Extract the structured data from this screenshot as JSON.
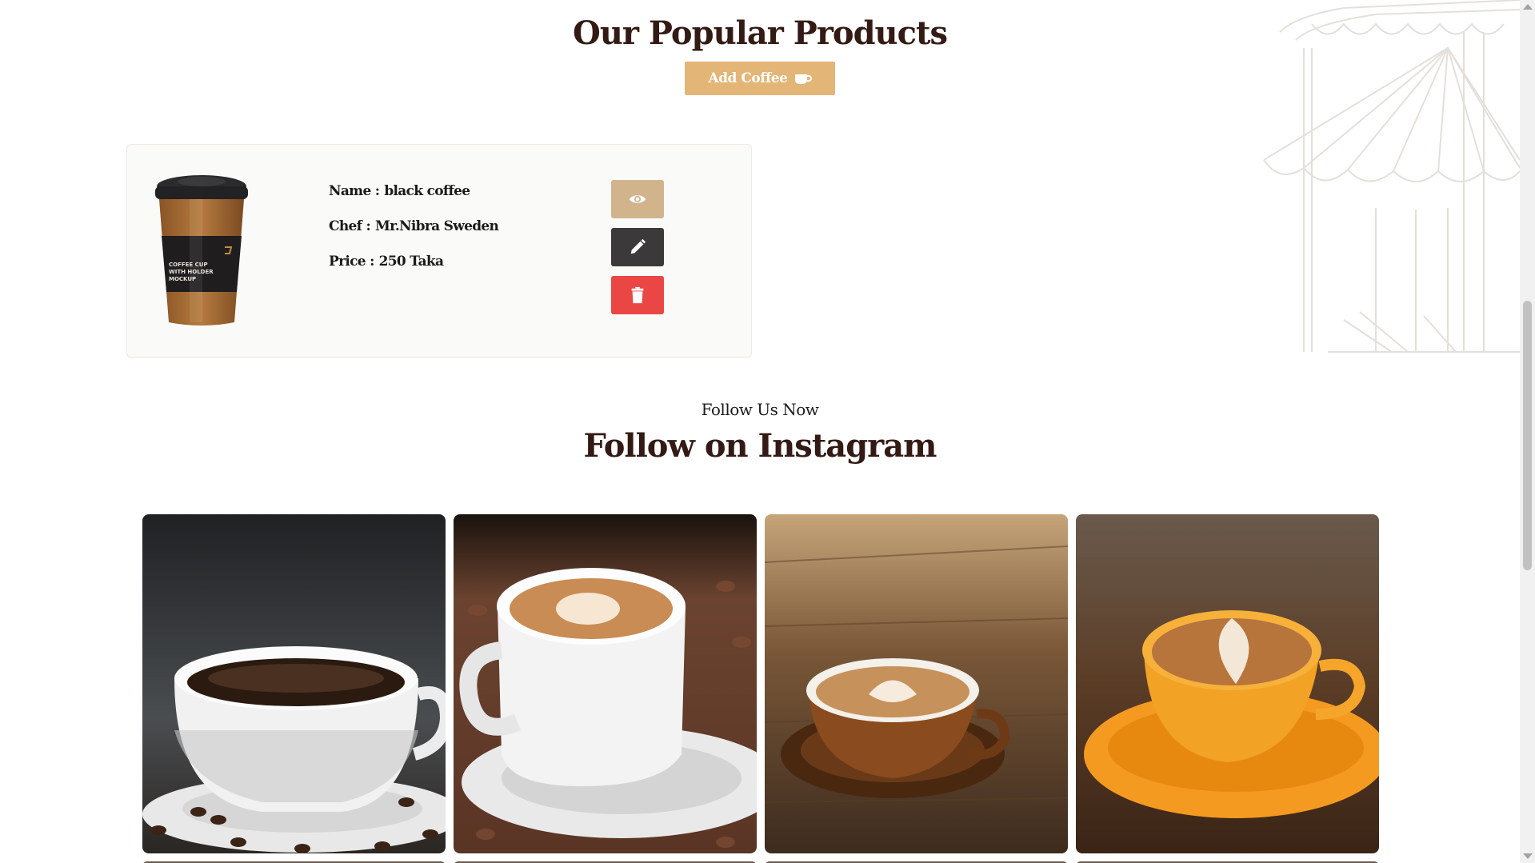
{
  "products_section": {
    "title": "Our Popular Products",
    "add_button_label": "Add Coffee"
  },
  "product": {
    "name_label": "Name :",
    "name": "black coffee",
    "chef_label": "Chef :",
    "chef": "Mr.Nibra Sweden",
    "price_label": "Price :",
    "price": "250 Taka",
    "cup_print": [
      "COFFEE CUP",
      "WITH HOLDER",
      "MOCKUP"
    ],
    "actions": [
      {
        "icon": "eye-icon",
        "color": "#d2b48c"
      },
      {
        "icon": "pencil-icon",
        "color": "#3c393b"
      },
      {
        "icon": "trash-icon",
        "color": "#ea4744"
      }
    ]
  },
  "instagram_section": {
    "subtitle": "Follow Us Now",
    "title": "Follow on Instagram"
  },
  "colors": {
    "accent": "#e3b577",
    "heading": "#331a15",
    "view": "#d2b48c",
    "edit": "#3c393b",
    "delete": "#ea4744"
  }
}
